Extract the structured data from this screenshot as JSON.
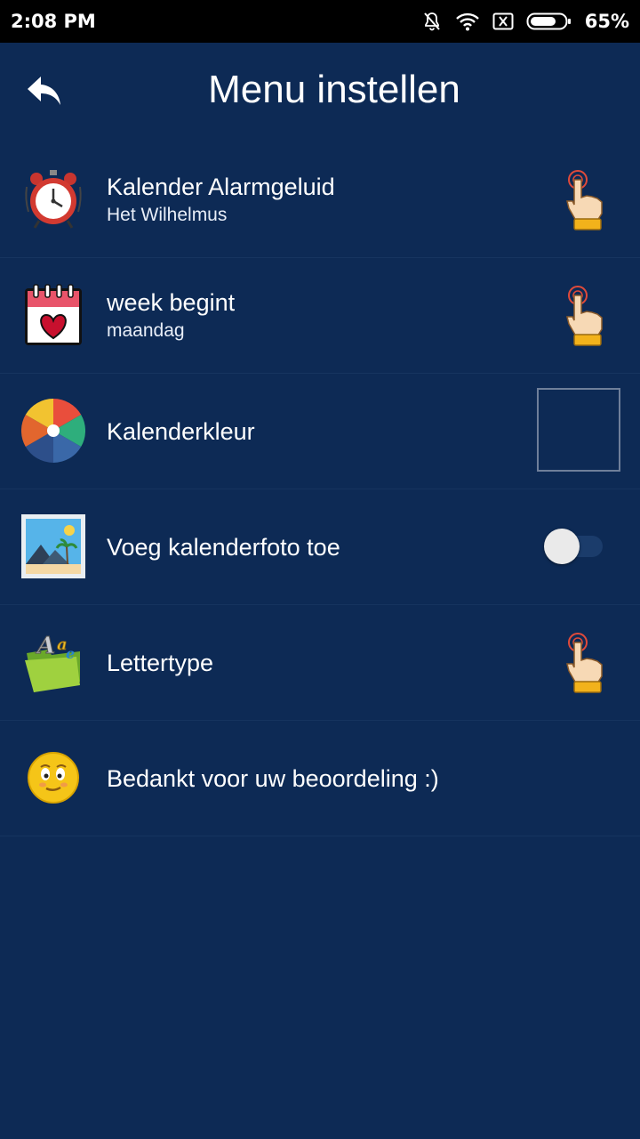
{
  "status": {
    "time": "2:08 PM",
    "battery": "65%",
    "icons": [
      "notifications-off-icon",
      "wifi-icon",
      "sim-x-icon",
      "battery-icon"
    ]
  },
  "header": {
    "title": "Menu instellen",
    "back_icon": "back-arrow-icon"
  },
  "items": [
    {
      "title": "Kalender Alarmgeluid",
      "subtitle": "Het Wilhelmus",
      "icon": "alarm-clock-icon",
      "action": "tap-hand-icon"
    },
    {
      "title": "week begint",
      "subtitle": "maandag",
      "icon": "calendar-heart-icon",
      "action": "tap-hand-icon"
    },
    {
      "title": "Kalenderkleur",
      "icon": "color-wheel-icon",
      "action": "color-swatch"
    },
    {
      "title": "Voeg kalenderfoto toe",
      "icon": "photo-icon",
      "action": "toggle",
      "toggle_on": false
    },
    {
      "title": "Lettertype",
      "icon": "font-folder-icon",
      "action": "tap-hand-icon"
    },
    {
      "title": "Bedankt voor uw beoordeling :)",
      "icon": "smiley-icon"
    }
  ],
  "colors": {
    "background": "#0d2a55",
    "divider": "#16345f",
    "status_bar": "#000000"
  }
}
